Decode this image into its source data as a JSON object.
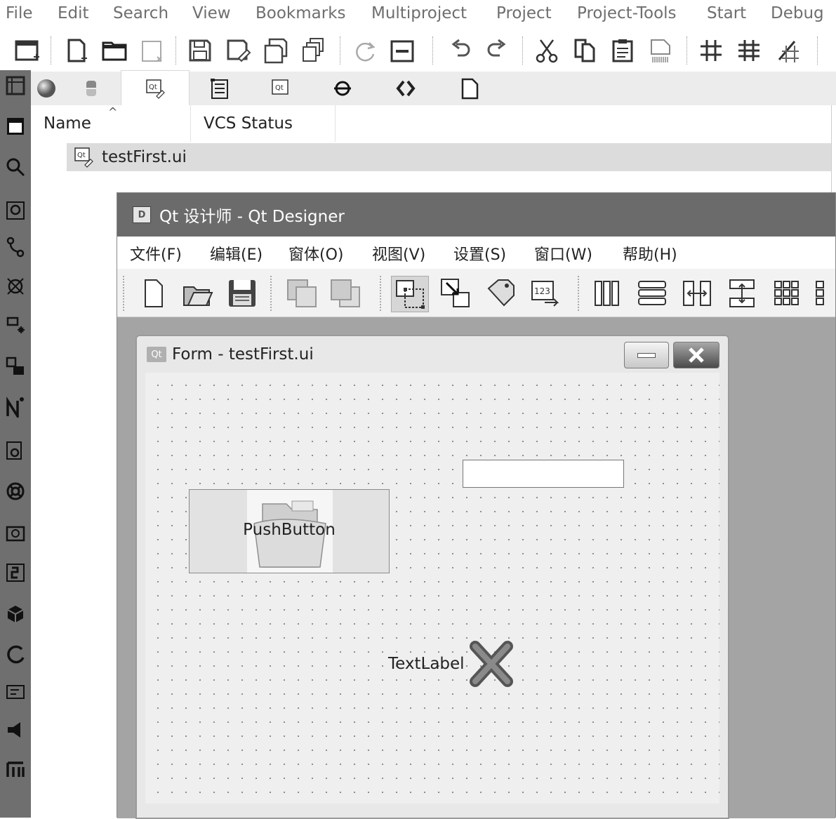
{
  "menubar": {
    "items": [
      "File",
      "Edit",
      "Search",
      "View",
      "Bookmarks",
      "Multiproject",
      "Project",
      "Project-Tools",
      "Start",
      "Debug"
    ]
  },
  "toolbar": {
    "icons": [
      "new-window-icon",
      "new-file-icon",
      "open-icon",
      "close-icon",
      "save-icon",
      "save-as-icon",
      "save-copy-icon",
      "save-all-icon",
      "reload-icon",
      "print-icon",
      "undo-icon",
      "redo-icon",
      "cut-icon",
      "copy-icon",
      "paste-icon",
      "clear-icon",
      "indent-icon",
      "unindent-icon",
      "comment-icon"
    ]
  },
  "browser": {
    "columns": [
      "Name",
      "VCS Status"
    ],
    "file": "testFirst.ui"
  },
  "designer": {
    "title": "Qt 设计师 - Qt Designer",
    "menu": [
      "文件(F)",
      "编辑(E)",
      "窗体(O)",
      "视图(V)",
      "设置(S)",
      "窗口(W)",
      "帮助(H)"
    ],
    "badge": "D"
  },
  "form": {
    "title": "Form - testFirst.ui",
    "badge": "Qt",
    "push_button": "PushButton",
    "text_label": "TextLabel"
  },
  "icon_labels": {
    "qt": "Qt",
    "num": "123"
  }
}
